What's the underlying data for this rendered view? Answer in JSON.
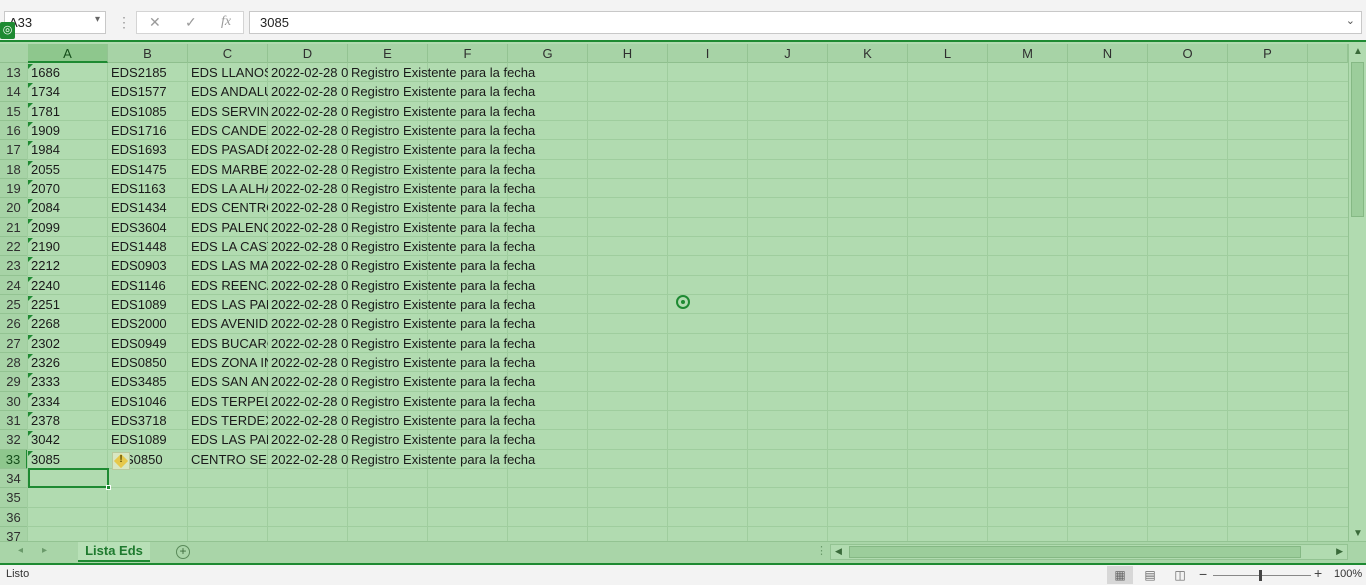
{
  "formula_bar": {
    "name_box": "A33",
    "cancel_icon": "✕",
    "enter_icon": "✓",
    "function_icon": "fx",
    "formula_value": "3085"
  },
  "columns": [
    "A",
    "B",
    "C",
    "D",
    "E",
    "F",
    "G",
    "H",
    "I",
    "J",
    "K",
    "L",
    "M",
    "N",
    "O",
    "P"
  ],
  "selected_column": "A",
  "selected_row": "33",
  "rows": [
    {
      "num": "13",
      "a": "1686",
      "b": "EDS2185",
      "c": "EDS LLANOS",
      "d": "2022-02-28 0",
      "e": "Registro Existente para la fecha"
    },
    {
      "num": "14",
      "a": "1734",
      "b": "EDS1577",
      "c": "EDS ANDALU",
      "d": "2022-02-28 0",
      "e": "Registro Existente para la fecha"
    },
    {
      "num": "15",
      "a": "1781",
      "b": "EDS1085",
      "c": "EDS SERVINC",
      "d": "2022-02-28 0",
      "e": "Registro Existente para la fecha"
    },
    {
      "num": "16",
      "a": "1909",
      "b": "EDS1716",
      "c": "EDS CANDEL",
      "d": "2022-02-28 0",
      "e": "Registro Existente para la fecha"
    },
    {
      "num": "17",
      "a": "1984",
      "b": "EDS1693",
      "c": "EDS PASADEI",
      "d": "2022-02-28 0",
      "e": "Registro Existente para la fecha"
    },
    {
      "num": "18",
      "a": "2055",
      "b": "EDS1475",
      "c": "EDS MARBEL",
      "d": "2022-02-28 0",
      "e": "Registro Existente para la fecha"
    },
    {
      "num": "19",
      "a": "2070",
      "b": "EDS1163",
      "c": "EDS LA ALHA",
      "d": "2022-02-28 0",
      "e": "Registro Existente para la fecha"
    },
    {
      "num": "20",
      "a": "2084",
      "b": "EDS1434",
      "c": "EDS CENTRO",
      "d": "2022-02-28 0",
      "e": "Registro Existente para la fecha"
    },
    {
      "num": "21",
      "a": "2099",
      "b": "EDS3604",
      "c": "EDS PALENQ",
      "d": "2022-02-28 0",
      "e": "Registro Existente para la fecha"
    },
    {
      "num": "22",
      "a": "2190",
      "b": "EDS1448",
      "c": "EDS LA CASTI",
      "d": "2022-02-28 0",
      "e": "Registro Existente para la fecha"
    },
    {
      "num": "23",
      "a": "2212",
      "b": "EDS0903",
      "c": "EDS LAS MAI",
      "d": "2022-02-28 0",
      "e": "Registro Existente para la fecha"
    },
    {
      "num": "24",
      "a": "2240",
      "b": "EDS1146",
      "c": "EDS REENCAI",
      "d": "2022-02-28 0",
      "e": "Registro Existente para la fecha"
    },
    {
      "num": "25",
      "a": "2251",
      "b": "EDS1089",
      "c": "EDS LAS PALI",
      "d": "2022-02-28 0",
      "e": "Registro Existente para la fecha"
    },
    {
      "num": "26",
      "a": "2268",
      "b": "EDS2000",
      "c": "EDS AVENIDA",
      "d": "2022-02-28 0",
      "e": "Registro Existente para la fecha"
    },
    {
      "num": "27",
      "a": "2302",
      "b": "EDS0949",
      "c": "EDS BUCARO",
      "d": "2022-02-28 0",
      "e": "Registro Existente para la fecha"
    },
    {
      "num": "28",
      "a": "2326",
      "b": "EDS0850",
      "c": "EDS ZONA IN",
      "d": "2022-02-28 0",
      "e": "Registro Existente para la fecha"
    },
    {
      "num": "29",
      "a": "2333",
      "b": "EDS3485",
      "c": "EDS SAN ANT",
      "d": "2022-02-28 0",
      "e": "Registro Existente para la fecha"
    },
    {
      "num": "30",
      "a": "2334",
      "b": "EDS1046",
      "c": "EDS TERPEL [",
      "d": "2022-02-28 0",
      "e": "Registro Existente para la fecha"
    },
    {
      "num": "31",
      "a": "2378",
      "b": "EDS3718",
      "c": "EDS TERDEX",
      "d": "2022-02-28 0",
      "e": "Registro Existente para la fecha"
    },
    {
      "num": "32",
      "a": "3042",
      "b": "EDS1089",
      "c": "EDS LAS PALI",
      "d": "2022-02-28 0",
      "e": "Registro Existente para la fecha"
    },
    {
      "num": "33",
      "a": "3085",
      "b": "S0850",
      "c": "CENTRO SER'",
      "d": "2022-02-28 0",
      "e": "Registro Existente para la fecha"
    },
    {
      "num": "34",
      "a": "",
      "b": "",
      "c": "",
      "d": "",
      "e": ""
    },
    {
      "num": "35",
      "a": "",
      "b": "",
      "c": "",
      "d": "",
      "e": ""
    },
    {
      "num": "36",
      "a": "",
      "b": "",
      "c": "",
      "d": "",
      "e": ""
    },
    {
      "num": "37",
      "a": "",
      "b": "",
      "c": "",
      "d": "",
      "e": ""
    }
  ],
  "sheet_tabs": {
    "active": "Lista Eds",
    "add_icon": "+"
  },
  "status_bar": {
    "status": "Listo",
    "zoom": "100%",
    "zoom_minus": "−",
    "zoom_plus": "+"
  },
  "icons": {
    "overlay_badge": "target-icon",
    "error_indicator": "warning-diamond-icon",
    "cursor_target": "crosshair-target-icon"
  },
  "colors": {
    "overlay_green": "#b1dbb0",
    "accent_green": "#1e8a32"
  }
}
